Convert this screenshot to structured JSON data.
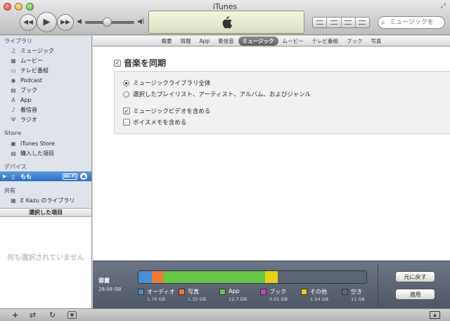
{
  "window": {
    "title": "iTunes"
  },
  "toolbar": {
    "prev_icon": "◀◀",
    "play_icon": "▶",
    "next_icon": "▶▶",
    "volume_low_icon": "◀",
    "volume_high_icon": "◀)",
    "volume_level": 0.45,
    "search_placeholder": "ミュージックを"
  },
  "sidebar": {
    "library_header": "ライブラリ",
    "library_items": [
      {
        "label": "ミュージック",
        "icon": "♫"
      },
      {
        "label": "ムービー",
        "icon": "▦"
      },
      {
        "label": "テレビ番組",
        "icon": "▭"
      },
      {
        "label": "Podcast",
        "icon": "◉"
      },
      {
        "label": "ブック",
        "icon": "▤"
      },
      {
        "label": "App",
        "icon": "A"
      },
      {
        "label": "着信音",
        "icon": "♪"
      },
      {
        "label": "ラジオ",
        "icon": "Ψ"
      }
    ],
    "store_header": "Store",
    "store_items": [
      {
        "label": "iTunes Store",
        "icon": "▣"
      },
      {
        "label": "購入した項目",
        "icon": "▤"
      }
    ],
    "devices_header": "デバイス",
    "device": {
      "label": "もも",
      "icon": "▯",
      "disclosure": "▶",
      "badge": "Wi-Fi",
      "eject": "⏏"
    },
    "shared_header": "共有",
    "shared_items": [
      {
        "label": "E Kazu のライブラリ",
        "icon": "▦"
      }
    ],
    "selected_header": "選択した項目",
    "nothing_selected": "何も選択されていません"
  },
  "tabs": [
    "概要",
    "情報",
    "App",
    "着信音",
    "ミュージック",
    "ムービー",
    "テレビ番組",
    "ブック",
    "写真"
  ],
  "active_tab": "ミュージック",
  "sync": {
    "title": "音楽を同期",
    "checked": true,
    "option_all": "ミュージックライブラリ全体",
    "option_selected": "選択したプレイリスト、アーティスト、アルバム、およびジャンル",
    "selected_option": "all",
    "include_videos": "ミュージックビデオを含める",
    "include_videos_checked": true,
    "include_memos": "ボイスメモを含める",
    "include_memos_checked": false
  },
  "capacity": {
    "title": "容量",
    "total": "28.08 GB",
    "segments": [
      {
        "label": "オーディオ",
        "size": "1.70 GB",
        "gb": 1.7,
        "color": "#4a8fd6"
      },
      {
        "label": "写真",
        "size": "1.32 GB",
        "gb": 1.32,
        "color": "#ee7a38"
      },
      {
        "label": "App",
        "size": "12.7 GB",
        "gb": 12.7,
        "color": "#65c648"
      },
      {
        "label": "ブック",
        "size": "0.01 GB",
        "gb": 0.01,
        "color": "#c444c8"
      },
      {
        "label": "その他",
        "size": "1.54 GB",
        "gb": 1.54,
        "color": "#e2d314"
      },
      {
        "label": "空き",
        "size": "11 GB",
        "gb": 11.0,
        "color": "#5c6575"
      }
    ],
    "revert_label": "元に戻す",
    "apply_label": "適用"
  },
  "bottom_bar": {
    "add_icon": "+",
    "shuffle_icon": "⇄",
    "repeat_icon": "↻",
    "show_icon": "▼",
    "airplay_icon": "▲"
  }
}
